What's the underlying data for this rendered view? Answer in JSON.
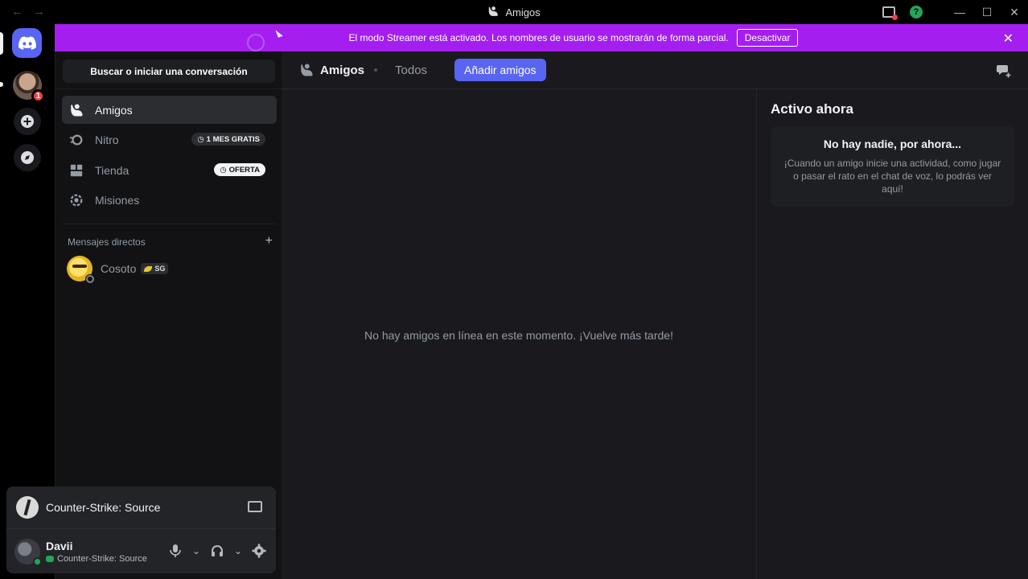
{
  "window": {
    "title": "Amigos"
  },
  "banner": {
    "message": "El modo Streamer está activado. Los nombres de usuario se mostrarán de forma parcial.",
    "button": "Desactivar"
  },
  "rail": {
    "guild_badge": "1"
  },
  "sidebar": {
    "search": "Buscar o iniciar una conversación",
    "items": [
      {
        "label": "Amigos"
      },
      {
        "label": "Nitro",
        "badge": "1 MES GRATIS"
      },
      {
        "label": "Tienda",
        "badge": "OFERTA"
      },
      {
        "label": "Misiones"
      }
    ],
    "dm_header": "Mensajes directos",
    "dms": [
      {
        "name": "Cosoto",
        "tag": "SG"
      }
    ]
  },
  "activity": {
    "game": "Counter-Strike: Source"
  },
  "user": {
    "name": "Davii",
    "status": "Counter-Strike: Source"
  },
  "main": {
    "title": "Amigos",
    "tab_all": "Todos",
    "add_friends": "Añadir amigos",
    "empty": "No hay amigos en línea en este momento. ¡Vuelve más tarde!"
  },
  "active_now": {
    "title": "Activo ahora",
    "empty_title": "No hay nadie, por ahora...",
    "empty_text": "¡Cuando un amigo inicie una actividad, como jugar o pasar el rato en el chat de voz, lo podrás ver aquí!"
  },
  "colors": {
    "accent": "#5865f2",
    "banner": "#a41fef",
    "online": "#23a55a",
    "danger": "#f23f43"
  },
  "icons": [
    "back-arrow-icon",
    "forward-arrow-icon",
    "friends-icon",
    "inbox-icon",
    "help-icon",
    "minimize-icon",
    "maximize-icon",
    "close-icon",
    "discord-logo-icon",
    "add-server-icon",
    "explore-icon",
    "nitro-icon",
    "shop-icon",
    "quests-icon",
    "plus-icon",
    "stream-icon",
    "microphone-icon",
    "headphones-icon",
    "gear-icon",
    "new-group-dm-icon"
  ]
}
